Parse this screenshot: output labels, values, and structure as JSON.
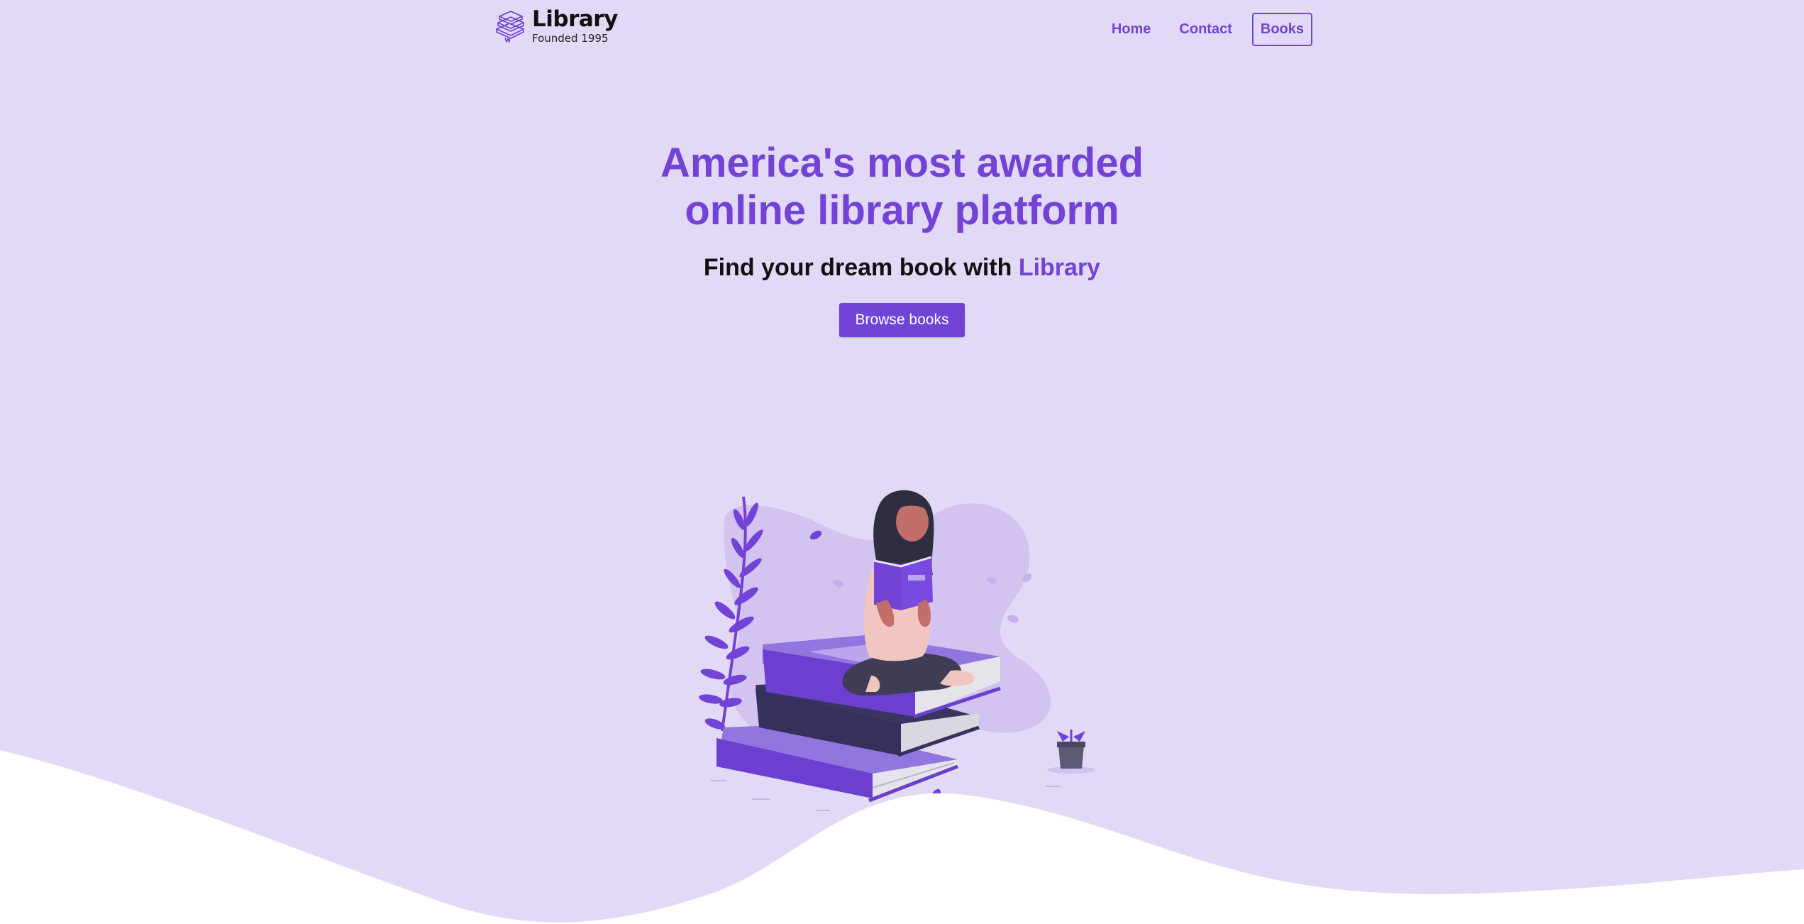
{
  "brand": {
    "name": "Library",
    "tagline": "Founded 1995",
    "logo_icon": "stacked-books-icon"
  },
  "nav": {
    "items": [
      {
        "label": "Home",
        "active": false
      },
      {
        "label": "Contact",
        "active": false
      },
      {
        "label": "Books",
        "active": true
      }
    ]
  },
  "hero": {
    "title_line1": "America's most awarded",
    "title_line2": "online library platform",
    "subtitle_prefix": "Find your dream book with",
    "subtitle_accent": "Library",
    "cta_label": "Browse books"
  },
  "illustration": {
    "name": "woman-reading-on-books-illustration"
  },
  "colors": {
    "accent": "#7342d6",
    "background": "#e2d9f6",
    "text": "#111111",
    "white": "#ffffff"
  }
}
